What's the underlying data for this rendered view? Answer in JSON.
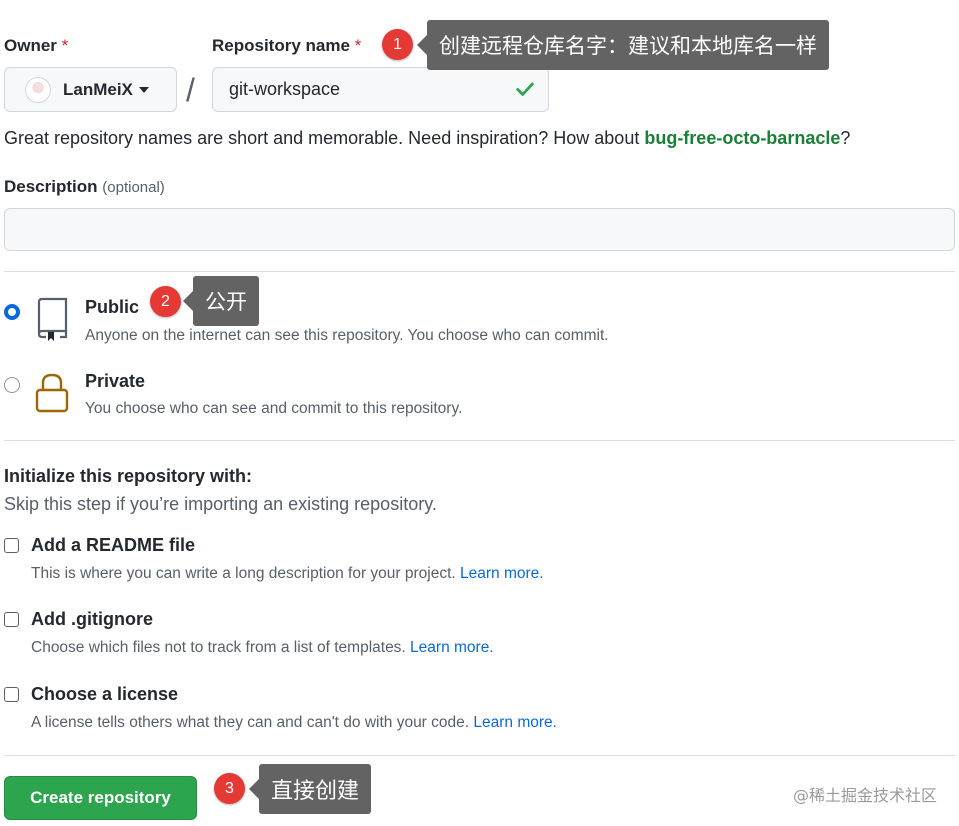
{
  "owner": {
    "label": "Owner",
    "required_mark": "*",
    "value": "LanMeiX"
  },
  "repo_name": {
    "label": "Repository name",
    "required_mark": "*",
    "value": "git-workspace"
  },
  "hint": {
    "text": "Great repository names are short and memorable. Need inspiration? How about ",
    "suggestion": "bug-free-octo-barnacle",
    "suffix": "?"
  },
  "description": {
    "label": "Description",
    "optional": "(optional)",
    "value": ""
  },
  "visibility": {
    "public": {
      "title": "Public",
      "desc": "Anyone on the internet can see this repository. You choose who can commit.",
      "selected": true
    },
    "private": {
      "title": "Private",
      "desc": "You choose who can see and commit to this repository.",
      "selected": false
    }
  },
  "init": {
    "title": "Initialize this repository with:",
    "subtitle": "Skip this step if you’re importing an existing repository.",
    "options": [
      {
        "title": "Add a README file",
        "desc": "This is where you can write a long description for your project. ",
        "link": "Learn more."
      },
      {
        "title": "Add .gitignore",
        "desc": "Choose which files not to track from a list of templates. ",
        "link": "Learn more."
      },
      {
        "title": "Choose a license",
        "desc": "A license tells others what they can and can't do with your code. ",
        "link": "Learn more."
      }
    ]
  },
  "create_button": "Create repository",
  "annotations": [
    {
      "number": "1",
      "text": "创建远程仓库名字：建议和本地库名一样"
    },
    {
      "number": "2",
      "text": "公开"
    },
    {
      "number": "3",
      "text": "直接创建"
    }
  ],
  "watermark": "@稀土掘金技术社区",
  "colors": {
    "primary_button": "#2da44e",
    "link": "#0969da",
    "suggestion": "#1a7f37",
    "required": "#cf222e",
    "badge": "#e53935",
    "tooltip": "#636363"
  }
}
